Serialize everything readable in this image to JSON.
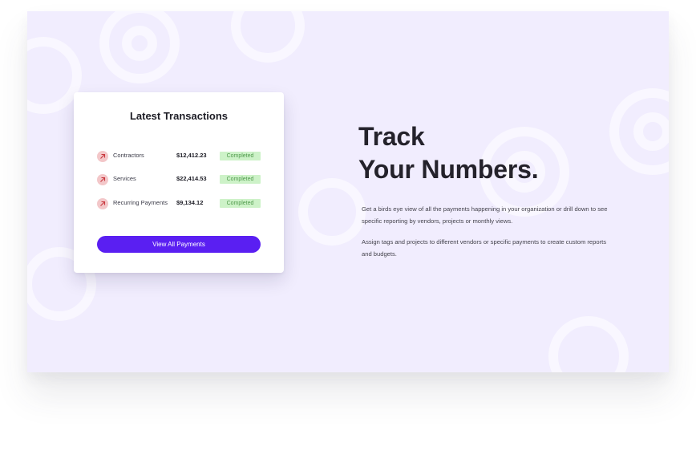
{
  "card": {
    "title": "Latest Transactions",
    "transactions": [
      {
        "label": "Contractors",
        "amount": "$12,412.23",
        "status": "Completed",
        "icon": "arrow-up-right-icon"
      },
      {
        "label": "Services",
        "amount": "$22,414.53",
        "status": "Completed",
        "icon": "arrow-up-right-icon"
      },
      {
        "label": "Recurring Payments",
        "amount": "$9,134.12",
        "status": "Completed",
        "icon": "arrow-up-right-icon"
      }
    ],
    "button_label": "View All Payments"
  },
  "hero": {
    "line1": "Track",
    "line2": "Your Numbers.",
    "paragraph1": "Get a birds eye view of all the payments happening in your organization or drill down to see specific reporting by vendors, projects or monthly views.",
    "paragraph2": "Assign tags and projects to different vendors or specific payments to create custom reports and budgets."
  },
  "colors": {
    "background": "#f1edfe",
    "accent": "#5a1ff2",
    "status_bg": "#cdf2c8",
    "status_text": "#4f9a4b",
    "icon_bg": "#f3c7c9"
  }
}
